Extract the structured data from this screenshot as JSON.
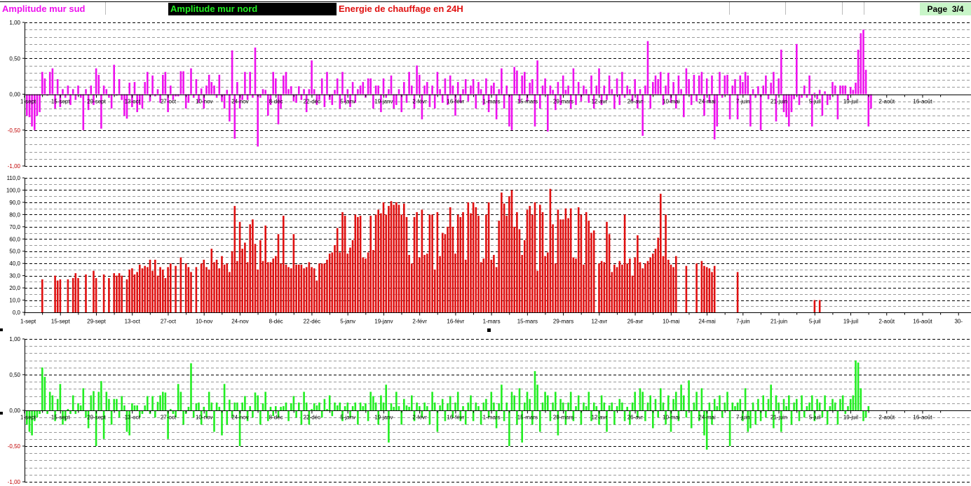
{
  "header": {
    "south_title": "Amplitude mur sud",
    "north_title": "Amplitude mur nord",
    "energy_title": "Energie de chauffage en 24H",
    "page_label": "Page  3/4"
  },
  "colors": {
    "south": "#ee11ee",
    "north": "#22ee22",
    "energy": "#e01010",
    "page_bg": "#c8f5c8"
  },
  "chart_data": [
    {
      "type": "bar",
      "name": "Amplitude mur sud",
      "ylim": [
        -1,
        1
      ],
      "yticks": [
        {
          "v": 1,
          "label": "1,00"
        },
        {
          "v": 0.5,
          "label": "0,50"
        },
        {
          "v": 0,
          "label": "0,00"
        },
        {
          "v": -0.5,
          "label": "-0,50"
        },
        {
          "v": -1,
          "label": "-1,00"
        }
      ],
      "xlabels": [
        "1-sept",
        "15-sept",
        "29-sept",
        "13-oct",
        "27-oct",
        "10-nov",
        "24-nov",
        "8-déc",
        "22-déc",
        "5-janv",
        "19-janv",
        "2-févr",
        "16-févr",
        "1-mars",
        "15-mars",
        "29-mars",
        "12-avr",
        "26-avr",
        "10-mai",
        "24-mai",
        "7-juin",
        "21-juin",
        "5-juil",
        "19-juil",
        "2-août",
        "16-août"
      ],
      "values": [
        -0.3,
        -0.32,
        -0.45,
        -0.5,
        -0.3,
        -0.25,
        0.31,
        0.22,
        -0.02,
        0.31,
        0.36,
        -0.2,
        0.21,
        -0.18,
        0.07,
        -0.05,
        0.12,
        -0.15,
        0.07,
        -0.08,
        0.12,
        -0.05,
        -0.5,
        0.07,
        -0.22,
        0.12,
        -0.15,
        0.36,
        0.27,
        -0.48,
        0.12,
        0.07,
        -0.05,
        -0.2,
        0.41,
        -0.02,
        0.21,
        -0.08,
        -0.3,
        -0.34,
        0.16,
        -0.18,
        0.17,
        -0.25,
        -0.15,
        -0.2,
        0.17,
        0.31,
        -0.1,
        0.26,
        -0.03,
        0.07,
        -0.12,
        0.27,
        0.31,
        -0.25,
        0.12,
        -0.08,
        -0.03,
        -0.03,
        0.32,
        0.32,
        -0.2,
        -0.12,
        0.36,
        -0.05,
        0.21,
        -0.12,
        0.08,
        -0.2,
        0.12,
        0.27,
        0.17,
        0.12,
        -0.05,
        0.27,
        -0.1,
        -0.2,
        0.06,
        -0.38,
        0.61,
        -0.62,
        0.17,
        -0.2,
        -0.08,
        0.31,
        -0.08,
        0.31,
        -0.05,
        0.65,
        -0.73,
        -0.05,
        0.07,
        0.06,
        -0.3,
        -0.15,
        0.31,
        0.22,
        -0.42,
        -0.2,
        0.26,
        0.31,
        0.07,
        0.11,
        -0.1,
        -0.12,
        0.11,
        -0.08,
        0.07,
        -0.25,
        0.07,
        0.47,
        0.07,
        -0.15,
        -0.08,
        0.22,
        -0.18,
        0.31,
        -0.08,
        -0.15,
        0.06,
        0.22,
        -0.2,
        0.31,
        -0.12,
        0.07,
        -0.18,
        0.17,
        -0.12,
        0.07,
        0.12,
        0.17,
        -0.05,
        0.22,
        0.22,
        -0.2,
        0.12,
        0.12,
        -0.25,
        0.22,
        -0.05,
        0.07,
        0.26,
        -0.2,
        -0.15,
        0.07,
        -0.25,
        0.17,
        -0.12,
        0.31,
        0.12,
        -0.2,
        0.4,
        0.27,
        -0.35,
        0.12,
        0.17,
        -0.18,
        0.12,
        -0.2,
        0.31,
        0.07,
        -0.12,
        0.22,
        -0.15,
        0.26,
        0.12,
        -0.3,
        0.17,
        -0.12,
        0.07,
        0.21,
        -0.1,
        0.12,
        0.21,
        -0.2,
        0.17,
        0.07,
        -0.15,
        0.22,
        -0.25,
        0.12,
        0.16,
        -0.35,
        0.07,
        0.36,
        -0.2,
        0.12,
        -0.45,
        -0.5,
        0.38,
        0.33,
        -0.12,
        0.26,
        0.31,
        -0.1,
        0.16,
        0.21,
        -0.45,
        0.47,
        -0.2,
        0.12,
        0.22,
        -0.52,
        0.12,
        0.06,
        -0.22,
        0.17,
        -0.15,
        0.26,
        0.06,
        0.12,
        -0.2,
        0.36,
        -0.15,
        0.17,
        -0.1,
        0.12,
        0.07,
        -0.12,
        0.26,
        -0.2,
        0.12,
        0.36,
        -0.15,
        0.12,
        -0.08,
        0.26,
        0.07,
        -0.2,
        0.22,
        -0.15,
        0.31,
        -0.05,
        0.12,
        0.07,
        -0.1,
        0.21,
        -0.2,
        0.07,
        -0.58,
        0.12,
        0.74,
        -0.2,
        0.17,
        0.26,
        0.21,
        0.31,
        -0.15,
        0.12,
        0.3,
        -0.12,
        0.17,
        -0.2,
        0.26,
        0.07,
        -0.32,
        0.36,
        0.21,
        -0.15,
        0.27,
        -0.1,
        0.26,
        0.31,
        -0.3,
        0.22,
        -0.12,
        0.26,
        -0.63,
        -0.45,
        0.31,
        -0.05,
        0.26,
        0.27,
        -0.35,
        0.12,
        0.21,
        -0.35,
        0.26,
        0.17,
        0.31,
        0.26,
        -0.45,
        0.07,
        -0.05,
        0.11,
        -0.5,
        0.12,
        0.26,
        -0.07,
        0.16,
        0.31,
        -0.38,
        0.22,
        0.62,
        -0.25,
        -0.32,
        -0.45,
        -0.25,
        -0.07,
        0.7,
        -0.15,
        -0.05,
        0.12,
        -0.05,
        0.26,
        -0.45,
        0.02,
        -0.07,
        0.06,
        -0.3,
        0.04,
        -0.15,
        -0.08,
        0.17,
        0.12,
        -0.35,
        0.12,
        0.12,
        0.12,
        -0.08,
        0.1,
        0.06,
        0.16,
        0.62,
        0.85,
        0.9,
        0.34,
        -0.45,
        -0.2
      ]
    },
    {
      "type": "bar",
      "name": "Energie de chauffage en 24H",
      "ylim": [
        0,
        110
      ],
      "yticks": [
        {
          "v": 110,
          "label": "110,0"
        },
        {
          "v": 100,
          "label": "100,0"
        },
        {
          "v": 90,
          "label": "90,0"
        },
        {
          "v": 80,
          "label": "80,0"
        },
        {
          "v": 70,
          "label": "70,0"
        },
        {
          "v": 60,
          "label": "60,0"
        },
        {
          "v": 50,
          "label": "50,0"
        },
        {
          "v": 40,
          "label": "40,0"
        },
        {
          "v": 30,
          "label": "30,0"
        },
        {
          "v": 20,
          "label": "20,0"
        },
        {
          "v": 10,
          "label": "10,0"
        },
        {
          "v": 0,
          "label": "0,0"
        }
      ],
      "xlabels": [
        "1-sept",
        "15-sept",
        "29-sept",
        "13-oct",
        "27-oct",
        "10-nov",
        "24-nov",
        "8-déc",
        "22-déc",
        "5-janv",
        "19-janv",
        "2-févr",
        "16-févr",
        "1-mars",
        "15-mars",
        "29-mars",
        "12-avr",
        "26-avr",
        "10-mai",
        "24-mai",
        "7-juin",
        "21-juin",
        "5-juil",
        "19-juil",
        "2-août",
        "16-août",
        "30-"
      ],
      "values": [
        0,
        0,
        0,
        0,
        0,
        0,
        27,
        0,
        0,
        0,
        0,
        30,
        26,
        27,
        0,
        0,
        27,
        0,
        28,
        32,
        28,
        0,
        0,
        31,
        0,
        0,
        34,
        28,
        0,
        0,
        31,
        0,
        28,
        0,
        32,
        30,
        32,
        30,
        0,
        27,
        35,
        36,
        31,
        33,
        39,
        36,
        38,
        37,
        43,
        34,
        43,
        30,
        37,
        35,
        28,
        37,
        40,
        0,
        38,
        0,
        45,
        0,
        40,
        37,
        33,
        0,
        37,
        0,
        40,
        43,
        37,
        35,
        52,
        41,
        43,
        36,
        46,
        39,
        40,
        33,
        50,
        87,
        42,
        74,
        52,
        57,
        41,
        72,
        76,
        56,
        35,
        59,
        42,
        71,
        41,
        41,
        44,
        46,
        64,
        40,
        79,
        39,
        37,
        36,
        64,
        39,
        39,
        39,
        36,
        37,
        41,
        37,
        36,
        26,
        40,
        40,
        40,
        43,
        48,
        49,
        55,
        69,
        49,
        82,
        79,
        48,
        53,
        59,
        80,
        78,
        79,
        45,
        44,
        49,
        79,
        51,
        80,
        84,
        81,
        90,
        80,
        87,
        91,
        88,
        90,
        88,
        80,
        89,
        78,
        47,
        40,
        78,
        82,
        45,
        84,
        47,
        48,
        80,
        80,
        35,
        82,
        46,
        65,
        64,
        70,
        86,
        70,
        48,
        80,
        78,
        82,
        43,
        90,
        81,
        90,
        86,
        79,
        41,
        44,
        80,
        90,
        43,
        47,
        37,
        75,
        98,
        89,
        79,
        95,
        100,
        70,
        82,
        68,
        47,
        59,
        84,
        87,
        80,
        90,
        34,
        88,
        82,
        46,
        49,
        101,
        72,
        40,
        84,
        76,
        76,
        85,
        77,
        85,
        45,
        44,
        86,
        80,
        39,
        82,
        75,
        65,
        67,
        0,
        40,
        42,
        41,
        74,
        64,
        33,
        39,
        37,
        42,
        39,
        80,
        40,
        44,
        30,
        45,
        63,
        41,
        36,
        40,
        42,
        45,
        48,
        52,
        61,
        97,
        46,
        80,
        43,
        39,
        37,
        46,
        0,
        0,
        0,
        38,
        0,
        0,
        0,
        40,
        0,
        42,
        38,
        37,
        36,
        33,
        38,
        0,
        0,
        0,
        0,
        0,
        0,
        0,
        0,
        33,
        0,
        0,
        0,
        0,
        0,
        0,
        0,
        0,
        0,
        0,
        0,
        0,
        0,
        0,
        0,
        0,
        0,
        0,
        0,
        0,
        0,
        0,
        0,
        0,
        0,
        0,
        0,
        0,
        0,
        10,
        0,
        10
      ]
    },
    {
      "type": "bar",
      "name": "Amplitude mur nord",
      "ylim": [
        -1,
        1
      ],
      "yticks": [
        {
          "v": 1,
          "label": "1,00"
        },
        {
          "v": 0.5,
          "label": "0,50"
        },
        {
          "v": 0,
          "label": "0,00"
        },
        {
          "v": -0.5,
          "label": "-0,50"
        },
        {
          "v": -1,
          "label": "-1,00"
        }
      ],
      "xlabels": [
        "1-sept",
        "15-sept",
        "29-sept",
        "13-oct",
        "27-oct",
        "10-nov",
        "24-nov",
        "8-déc",
        "22-déc",
        "5-janv",
        "19-janv",
        "2-févr",
        "16-févr",
        "1-mars",
        "15-mars",
        "29-mars",
        "12-avr",
        "26-avr",
        "10-mai",
        "24-mai",
        "7-juin",
        "21-juin",
        "5-juil",
        "19-juil",
        "2-août",
        "16-août"
      ],
      "values": [
        -0.2,
        -0.3,
        -0.35,
        -0.15,
        -0.1,
        -0.05,
        0.6,
        0.47,
        -0.05,
        0.26,
        0.21,
        -0.15,
        0.16,
        0.37,
        -0.2,
        -0.15,
        0.02,
        -0.05,
        0.21,
        -0.05,
        0.1,
        0.07,
        0.31,
        -0.1,
        -0.25,
        0.21,
        0.27,
        -0.5,
        0.26,
        0.41,
        -0.4,
        0.26,
        0.16,
        -0.2,
        0.16,
        0.16,
        -0.1,
        0.2,
        0.07,
        -0.3,
        -0.35,
        0.1,
        0.07,
        0.07,
        -0.1,
        -0.05,
        0.07,
        0.2,
        -0.05,
        0.2,
        -0.1,
        0.12,
        0.21,
        0.26,
        0.25,
        -0.4,
        0.02,
        -0.05,
        -0.1,
        0.37,
        0.26,
        -0.2,
        -0.05,
        0.05,
        0.66,
        -0.1,
        0.1,
        0.11,
        -0.2,
        0.05,
        -0.1,
        0.26,
        0.11,
        -0.3,
        0.11,
        0.05,
        -0.35,
        0.37,
        -0.2,
        0.15,
        -0.1,
        0.11,
        0.11,
        -0.5,
        0.11,
        0.2,
        -0.15,
        0.06,
        -0.1,
        0.25,
        0.21,
        -0.2,
        0.1,
        0.26,
        -0.15,
        0.05,
        -0.08,
        0.06,
        -0.1,
        0.05,
        0.06,
        0.11,
        -0.15,
        0.1,
        0.2,
        -0.1,
        0.11,
        -0.2,
        0.26,
        0.11,
        -0.2,
        0.02,
        0.1,
        0.07,
        0.11,
        -0.1,
        0.16,
        0.02,
        0.21,
        -0.08,
        0.11,
        0.07,
        0.11,
        -0.15,
        0.06,
        0.11,
        -0.1,
        0.06,
        0.11,
        -0.2,
        0.11,
        0.06,
        0.1,
        -0.15,
        0.26,
        0.2,
        0.11,
        -0.2,
        0.21,
        0.11,
        0.36,
        -0.45,
        0.1,
        0.05,
        0.26,
        0.06,
        -0.2,
        0.16,
        0.07,
        0.05,
        0.21,
        -0.15,
        0.11,
        0.06,
        -0.1,
        0.11,
        0.06,
        -0.2,
        0.26,
        0.11,
        -0.3,
        0.07,
        0.16,
        -0.15,
        0.1,
        0.2,
        -0.1,
        0.11,
        0.26,
        -0.15,
        0.06,
        -0.2,
        0.11,
        0.21,
        -0.15,
        0.11,
        0.06,
        -0.2,
        0.11,
        0.16,
        -0.1,
        0.26,
        0.11,
        -0.25,
        0.1,
        0.36,
        -0.15,
        0.11,
        -0.5,
        0.26,
        0.21,
        -0.2,
        0.31,
        -0.45,
        0.11,
        0.26,
        0.16,
        -0.2,
        0.55,
        0.36,
        -0.3,
        0.11,
        0.26,
        0.21,
        -0.15,
        0.11,
        0.26,
        -0.35,
        0.16,
        0.11,
        -0.2,
        0.11,
        0.26,
        -0.15,
        0.06,
        0.21,
        -0.2,
        0.11,
        0.06,
        0.26,
        -0.15,
        0.11,
        0.06,
        -0.2,
        0.21,
        0.11,
        -0.3,
        0.07,
        0.11,
        -0.2,
        0.06,
        0.16,
        0.11,
        -0.15,
        0.05,
        -0.2,
        0.11,
        0.26,
        -0.1,
        0.31,
        0.26,
        -0.15,
        0.11,
        0.21,
        -0.25,
        0.16,
        -0.1,
        0.31,
        0.11,
        -0.2,
        0.21,
        -0.3,
        0.16,
        0.26,
        -0.15,
        0.36,
        0.21,
        -0.1,
        0.42,
        -0.25,
        0.11,
        0.26,
        -0.15,
        0.31,
        -0.35,
        -0.55,
        0.11,
        -0.2,
        0.16,
        0.06,
        0.21,
        -0.1,
        0.11,
        0.26,
        -0.5,
        0.11,
        0.06,
        0.11,
        0.16,
        -0.15,
        0.31,
        -0.3,
        -0.25,
        0.11,
        -0.2,
        0.16,
        -0.15,
        0.21,
        -0.1,
        0.16,
        0.36,
        -0.25,
        0.21,
        0.11,
        -0.3,
        0.16,
        0.06,
        0.21,
        -0.2,
        0.11,
        0.16,
        -0.15,
        0.21,
        -0.1,
        0.06,
        0.11,
        0.21,
        -0.15,
        0.16,
        0.11,
        -0.1,
        0.21,
        -0.2,
        0.06,
        0.16,
        0.11,
        -0.2,
        0.16,
        0.21,
        -0.05,
        0.06,
        0.16,
        0.21,
        0.7,
        0.67,
        0.31,
        -0.15,
        -0.1,
        0.06,
        0
      ]
    }
  ]
}
